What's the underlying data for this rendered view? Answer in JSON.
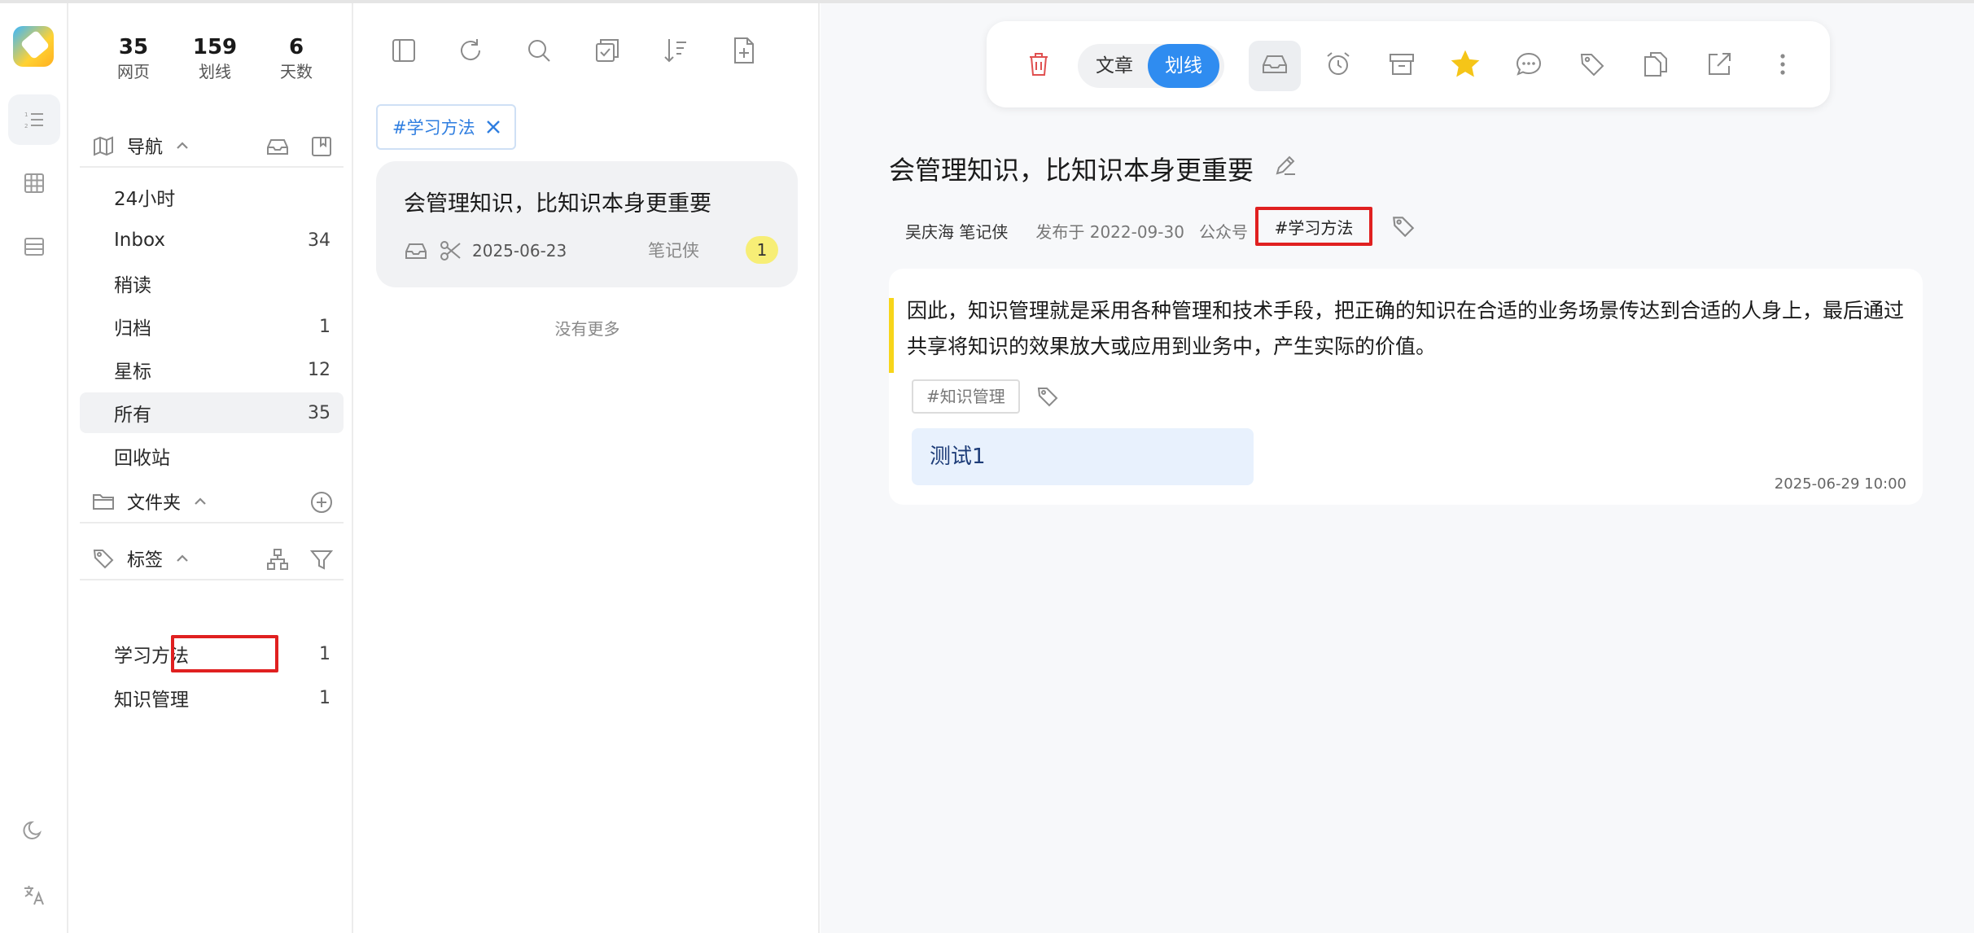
{
  "stats": [
    {
      "value": "35",
      "label": "网页"
    },
    {
      "value": "159",
      "label": "划线"
    },
    {
      "value": "6",
      "label": "天数"
    }
  ],
  "nav": {
    "title": "导航",
    "items": [
      {
        "label": "24小时",
        "count": ""
      },
      {
        "label": "Inbox",
        "count": "34"
      },
      {
        "label": "稍读",
        "count": ""
      },
      {
        "label": "归档",
        "count": "1"
      },
      {
        "label": "星标",
        "count": "12"
      },
      {
        "label": "所有",
        "count": "35"
      },
      {
        "label": "回收站",
        "count": ""
      }
    ]
  },
  "folders": {
    "title": "文件夹"
  },
  "tags": {
    "title": "标签",
    "items": [
      {
        "label": "学习方法",
        "count": "1"
      },
      {
        "label": "知识管理",
        "count": "1"
      }
    ]
  },
  "list": {
    "filter_chip": "#学习方法",
    "card": {
      "title": "会管理知识，比知识本身更重要",
      "date": "2025-06-23",
      "source": "笔记侠",
      "badge": "1"
    },
    "no_more": "没有更多"
  },
  "reader": {
    "segment": {
      "article": "文章",
      "highlight": "划线"
    },
    "title": "会管理知识，比知识本身更重要",
    "author": "吴庆海 笔记侠",
    "published": "发布于 2022-09-30",
    "channel": "公众号",
    "tag": "#学习方法",
    "highlight": {
      "text": "因此，知识管理就是采用各种管理和技术手段，把正确的知识在合适的业务场景传达到合适的人身上，最后通过共享将知识的效果放大或应用到业务中，产生实际的价值。",
      "tag": "#知识管理",
      "note": "测试1",
      "time": "2025-06-29 10:00"
    }
  },
  "colors": {
    "accent": "#2f8cf0",
    "highlight_bar": "#f7d51a",
    "star": "#f5c518",
    "delete": "#e05050"
  }
}
